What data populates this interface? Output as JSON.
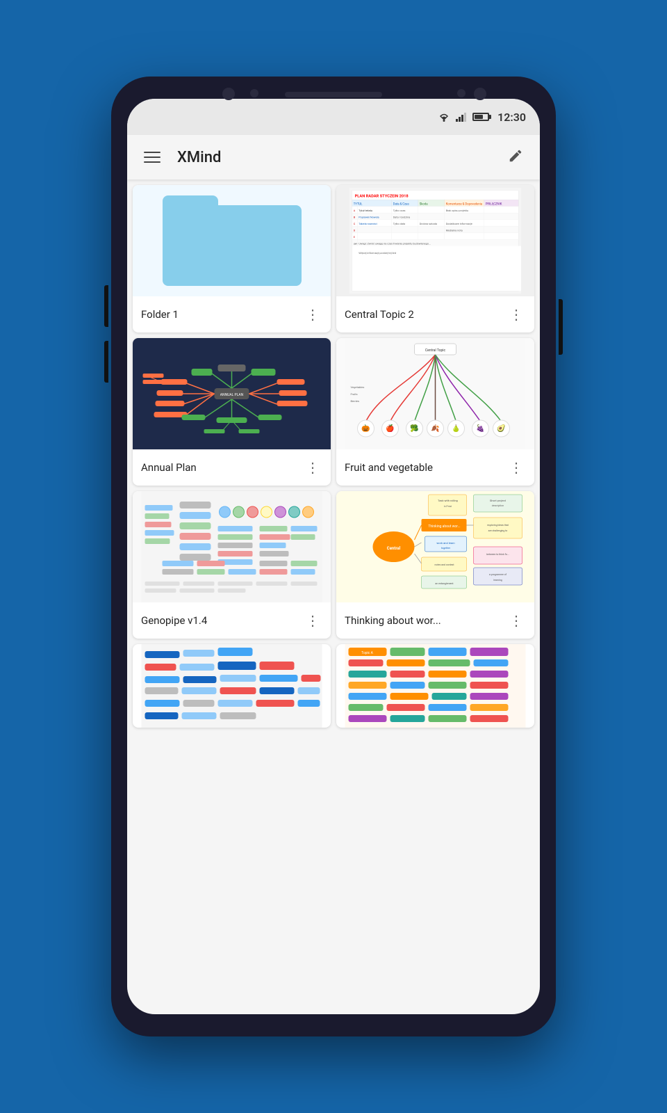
{
  "status_bar": {
    "time": "12:30",
    "battery_label": "battery"
  },
  "app_bar": {
    "title": "XMind",
    "edit_icon": "✎"
  },
  "cards": [
    {
      "id": "folder1",
      "title": "Folder 1",
      "type": "folder"
    },
    {
      "id": "central-topic-2",
      "title": "Central Topic 2",
      "type": "spreadsheet"
    },
    {
      "id": "annual-plan",
      "title": "Annual Plan",
      "type": "mindmap-dark"
    },
    {
      "id": "fruit-vegetable",
      "title": "Fruit and vegetable",
      "type": "fruit"
    },
    {
      "id": "genopipe",
      "title": "Genopipe v1.4",
      "type": "genopipe"
    },
    {
      "id": "thinking-about",
      "title": "Thinking about wor...",
      "type": "thinking"
    },
    {
      "id": "partial-left",
      "title": "",
      "type": "partial-light"
    },
    {
      "id": "partial-right",
      "title": "",
      "type": "partial-colorful"
    }
  ],
  "fab": {
    "label": "+",
    "color": "#f4511e"
  }
}
